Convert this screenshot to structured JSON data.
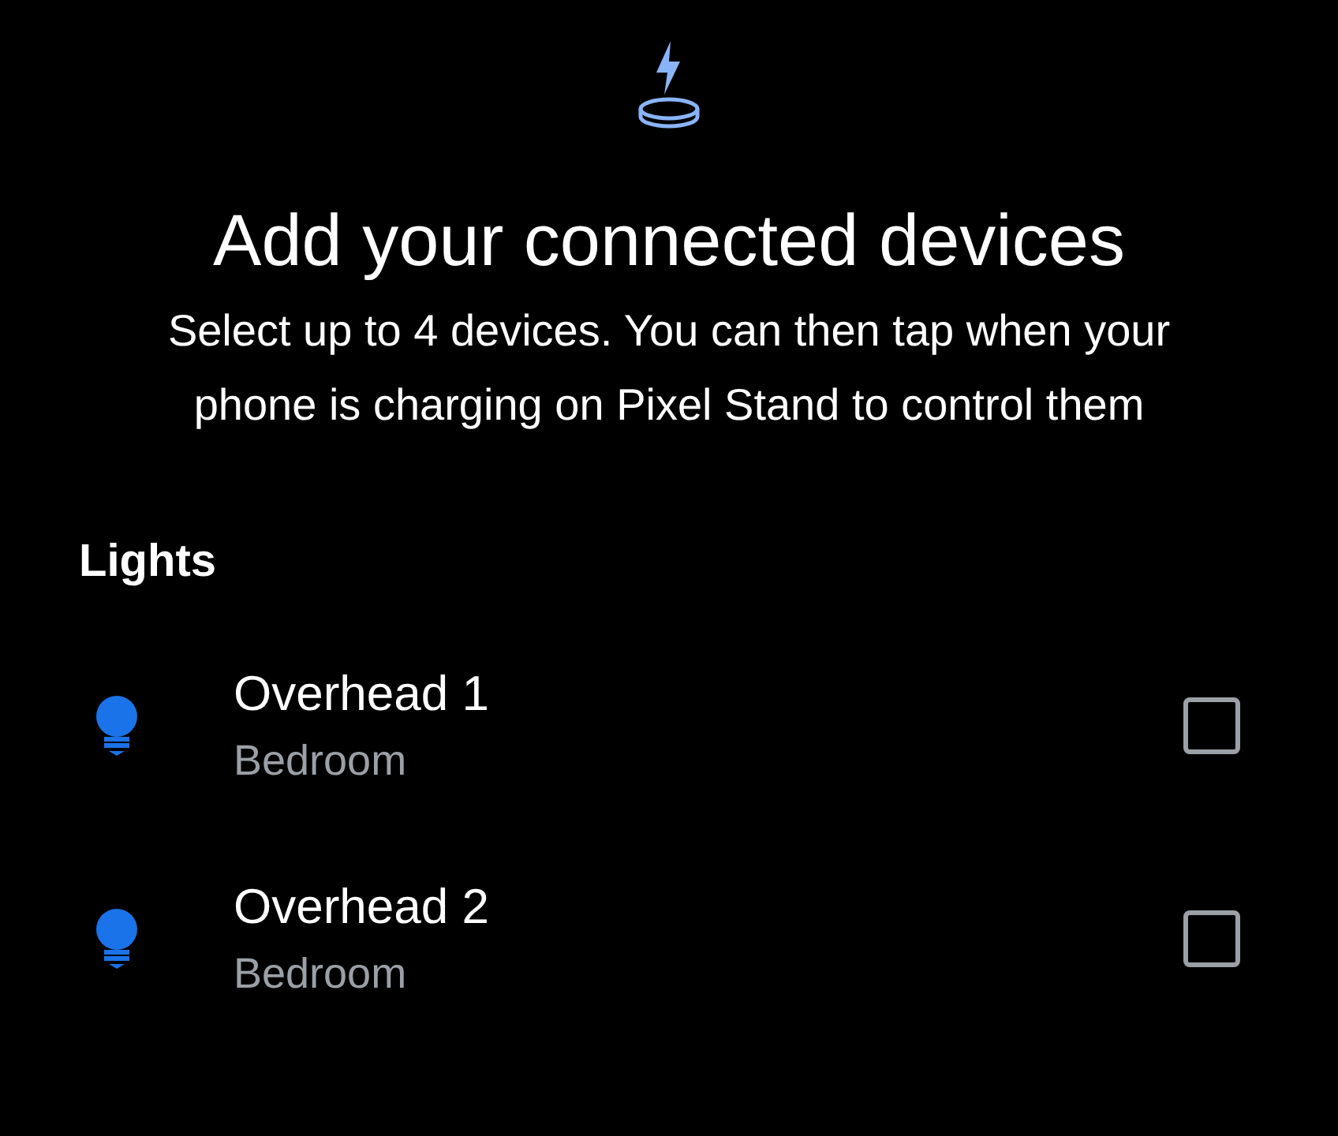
{
  "header": {
    "title": "Add your connected devices",
    "description": "Select up to 4 devices. You can then tap when your phone is charging on Pixel Stand to control them"
  },
  "sections": [
    {
      "title": "Lights",
      "devices": [
        {
          "name": "Overhead 1",
          "room": "Bedroom",
          "checked": false
        },
        {
          "name": "Overhead 2",
          "room": "Bedroom",
          "checked": false
        }
      ]
    }
  ]
}
